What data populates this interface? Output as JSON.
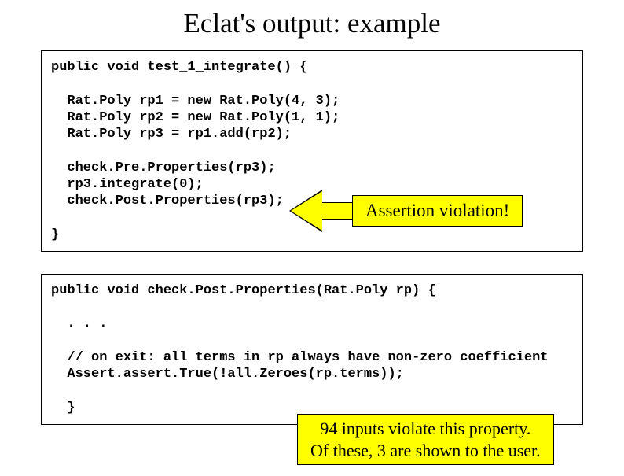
{
  "title": "Eclat's output: example",
  "box1": {
    "line1": "public void test_1_integrate() {",
    "blank1": "",
    "line2": "  Rat.Poly rp1 = new Rat.Poly(4, 3);",
    "line3": "  Rat.Poly rp2 = new Rat.Poly(1, 1);",
    "line4": "  Rat.Poly rp3 = rp1.add(rp2);",
    "blank2": "",
    "line5": "  check.Pre.Properties(rp3);",
    "line6": "  rp3.integrate(0);",
    "line7": "  check.Post.Properties(rp3);",
    "blank3": "",
    "line8": "}"
  },
  "callout1_text": "Assertion violation!",
  "box2": {
    "line1": "public void check.Post.Properties(Rat.Poly rp) {",
    "blank1": "",
    "line2": "  . . .",
    "blank2": "",
    "line3": "  // on exit: all terms in rp always have non-zero coefficient",
    "line4": "  Assert.assert.True(!all.Zeroes(rp.terms));",
    "blank3": "",
    "line5": "  }"
  },
  "callout2_line1": "94 inputs violate this property.",
  "callout2_line2": "Of these, 3 are shown to the user."
}
